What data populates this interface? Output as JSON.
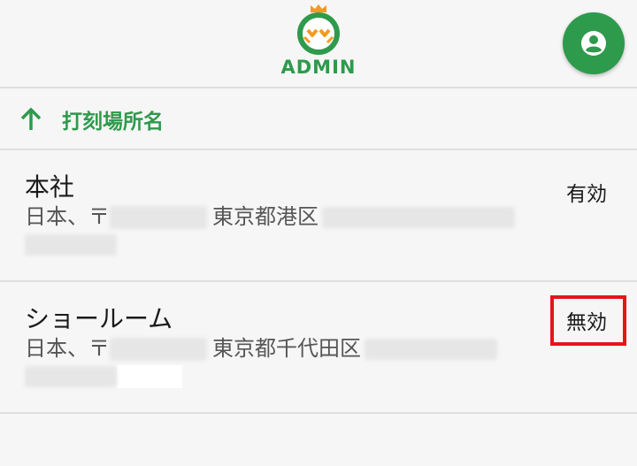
{
  "header": {
    "logo_text": "ADMIN",
    "account_icon": "account-circle-icon",
    "brand_color": "#2e9a4c"
  },
  "sort": {
    "icon": "arrow-up-icon",
    "label": "打刻場所名"
  },
  "locations": [
    {
      "name": "本社",
      "address_prefix": "日本、〒",
      "address_city": "東京都港区",
      "status": "有効"
    },
    {
      "name": "ショールーム",
      "address_prefix": "日本、〒",
      "address_city": "東京都千代田区",
      "status": "無効",
      "highlight_color": "#e8141b"
    }
  ]
}
